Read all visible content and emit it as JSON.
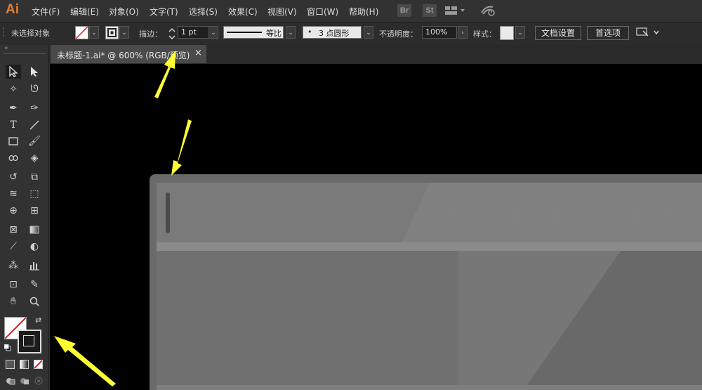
{
  "app": {
    "logo": "Ai"
  },
  "menu": [
    "文件(F)",
    "编辑(E)",
    "对象(O)",
    "文字(T)",
    "选择(S)",
    "效果(C)",
    "视图(V)",
    "窗口(W)",
    "帮助(H)"
  ],
  "menu_icons": {
    "br": "Br",
    "st": "St"
  },
  "control": {
    "selection_status": "未选择对象",
    "stroke_label": "描边：",
    "stroke_weight": "1 pt",
    "profile_label": "等比",
    "brush_label": "3 点圆形",
    "brush_dot": "•",
    "opacity_label": "不透明度：",
    "opacity_value": "100%",
    "style_label": "样式：",
    "doc_setup": "文档设置",
    "preferences": "首选项"
  },
  "document_tab": {
    "title": "未标题-1.ai* @ 600% (RGB/预览)",
    "close": "×"
  },
  "tools": [
    "selection-tool",
    "direct-selection-tool",
    "magic-wand-tool",
    "lasso-tool",
    "pen-tool",
    "curvature-tool",
    "type-tool",
    "line-tool",
    "rectangle-tool",
    "paintbrush-tool",
    "shaper-tool",
    "eraser-tool",
    "rotate-tool",
    "scale-tool",
    "warp-tool",
    "free-transform-tool",
    "shape-builder-tool",
    "perspective-tool",
    "mesh-tool",
    "gradient-tool",
    "eyedropper-tool",
    "blend-tool",
    "symbol-sprayer-tool",
    "column-graph-tool",
    "artboard-tool",
    "slice-tool",
    "hand-tool",
    "zoom-tool"
  ],
  "colors": {
    "menubar": "#323232",
    "controlbar": "#2c2c2c",
    "canvas": "#000000",
    "artboard": "#6a6a6a",
    "arrow": "#ffff33",
    "logo": "#e0802f"
  }
}
